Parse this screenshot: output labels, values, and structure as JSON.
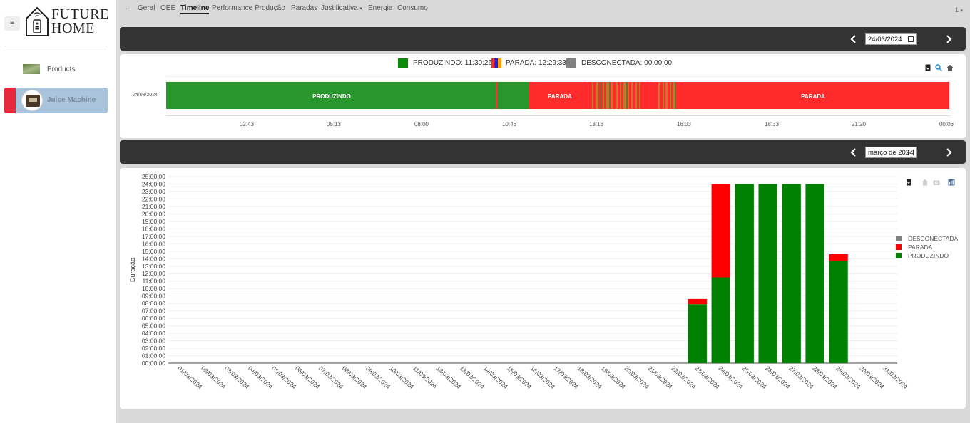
{
  "sidebar": {
    "menu_icon": "hamburger-icon",
    "logo": {
      "line1": "FUTURE",
      "line2": "HOME"
    },
    "items": [
      {
        "label": "Products",
        "icon": "products-thumbnail"
      },
      {
        "label": "Juice Machine",
        "icon": "machine-avatar",
        "active": true
      }
    ]
  },
  "nav": {
    "back_icon": "arrow-left-icon",
    "tabs": [
      "Geral",
      "OEE",
      "Timeline",
      "Performance",
      "Produção",
      "Paradas",
      "Justificativa",
      "Energia",
      "Consumo"
    ],
    "active": "Timeline",
    "justificativa_caret": "▾",
    "user": "1",
    "user_caret": "▾"
  },
  "timeline_bar": {
    "date": "24/03/2024"
  },
  "timeline": {
    "legend": [
      {
        "label": "PRODUZINDO: 11:30:26",
        "color": "#0b8a0b"
      },
      {
        "label": "PARADA: 12:29:33",
        "color": "#ff2a2a"
      },
      {
        "label": "DESCONECTADA: 00:00:00",
        "color": "#808080"
      }
    ],
    "row_label": "24/03/2024",
    "segment_labels": [
      "PRODUZINDO",
      "PARADA",
      "PARADA"
    ],
    "ticks": [
      "02:43",
      "05:13",
      "08:00",
      "10:46",
      "13:16",
      "16:03",
      "18:33",
      "21:20",
      "00:06"
    ],
    "tools": [
      "export-icon",
      "zoom-icon",
      "home-icon"
    ]
  },
  "month_bar": {
    "month": "março de 2024"
  },
  "chart_data": {
    "type": "bar",
    "stacked": true,
    "ylabel": "Duração",
    "xlabel": "",
    "y_ticks": [
      "00:00:00",
      "01:00:00",
      "02:00:00",
      "03:00:00",
      "04:00:00",
      "05:00:00",
      "06:00:00",
      "07:00:00",
      "08:00:00",
      "09:00:00",
      "10:00:00",
      "11:00:00",
      "12:00:00",
      "13:00:00",
      "14:00:00",
      "15:00:00",
      "16:00:00",
      "17:00:00",
      "18:00:00",
      "19:00:00",
      "20:00:00",
      "21:00:00",
      "22:00:00",
      "23:00:00",
      "24:00:00",
      "25:00:00"
    ],
    "ylim": [
      0,
      25
    ],
    "y_unit": "hours",
    "categories": [
      "01/03/2024",
      "02/03/2024",
      "03/03/2024",
      "04/03/2024",
      "05/03/2024",
      "06/03/2024",
      "07/03/2024",
      "08/03/2024",
      "09/03/2024",
      "10/03/2024",
      "11/03/2024",
      "12/03/2024",
      "13/03/2024",
      "14/03/2024",
      "15/03/2024",
      "16/03/2024",
      "17/03/2024",
      "18/03/2024",
      "19/03/2024",
      "20/03/2024",
      "21/03/2024",
      "22/03/2024",
      "23/03/2024",
      "24/03/2024",
      "25/03/2024",
      "26/03/2024",
      "27/03/2024",
      "28/03/2024",
      "29/03/2024",
      "30/03/2024",
      "31/03/2024"
    ],
    "series": [
      {
        "name": "PRODUZINDO",
        "color": "#008000",
        "values": [
          0,
          0,
          0,
          0,
          0,
          0,
          0,
          0,
          0,
          0,
          0,
          0,
          0,
          0,
          0,
          0,
          0,
          0,
          0,
          0,
          0,
          0,
          7.9,
          11.5,
          24,
          24,
          24,
          24,
          13.7,
          0,
          0
        ]
      },
      {
        "name": "PARADA",
        "color": "#ff0000",
        "values": [
          0,
          0,
          0,
          0,
          0,
          0,
          0,
          0,
          0,
          0,
          0,
          0,
          0,
          0,
          0,
          0,
          0,
          0,
          0,
          0,
          0,
          0,
          0.7,
          12.5,
          0,
          0,
          0,
          0,
          0.9,
          0,
          0
        ]
      },
      {
        "name": "DESCONECTADA",
        "color": "#808080",
        "values": [
          0,
          0,
          0,
          0,
          0,
          0,
          0,
          0,
          0,
          0,
          0,
          0,
          0,
          0,
          0,
          0,
          0,
          0,
          0,
          0,
          0,
          0,
          0,
          0,
          0,
          0,
          0,
          0,
          0,
          0,
          0
        ]
      }
    ],
    "legend": [
      "DESCONECTADA",
      "PARADA",
      "PRODUZINDO"
    ],
    "legend_position": "right",
    "grid": true,
    "tools": [
      "export-icon",
      "home-icon",
      "camera-icon",
      "bar-chart-icon"
    ]
  }
}
